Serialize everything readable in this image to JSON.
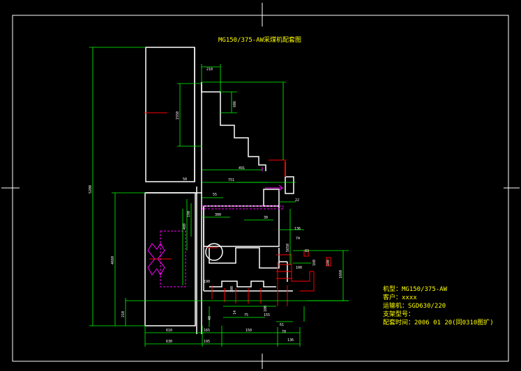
{
  "drawing": {
    "title": "MG150/375-AW采煤机配套图"
  },
  "info_block": {
    "lines": [
      "机型：MG150/375-AW",
      "客户：xxxx",
      "运输机：SGD630/220",
      "支架型号：",
      "配套时间：2006 01 20(同0310图扩)"
    ]
  },
  "dimensions": {
    "d_210": "210",
    "d_606": "606",
    "d_1550": "1550",
    "d_4660": "4660",
    "d_491": "491",
    "d_751": "751",
    "d_50a": "50",
    "d_55": "55",
    "d_22": "22",
    "d_300": "300",
    "d_30": "30",
    "d_480": "480",
    "d_190": "190",
    "d_5650": "5650",
    "d_136": "136",
    "d_74": "74",
    "d_83": "83",
    "d_100": "100",
    "d_1660": "1660",
    "d_160": "160",
    "d_190b": "190",
    "d_5200": "5200",
    "d_61": "61",
    "d_70": "70",
    "d_100b": "100",
    "d_210b": "210",
    "d_14": "14",
    "d_40": "40",
    "d_75": "75",
    "d_155": "155",
    "d_300b": "300",
    "d_610": "610",
    "d_630": "630",
    "d_165": "165",
    "d_195": "195",
    "d_150": "150",
    "d_136b": "136",
    "d_100c": "100"
  },
  "colors": {
    "background": "#000000",
    "frame": "#ffffff",
    "dimension": "#00ff00",
    "center": "#ff0000",
    "hidden": "#ff00ff",
    "title": "#ffff00"
  }
}
